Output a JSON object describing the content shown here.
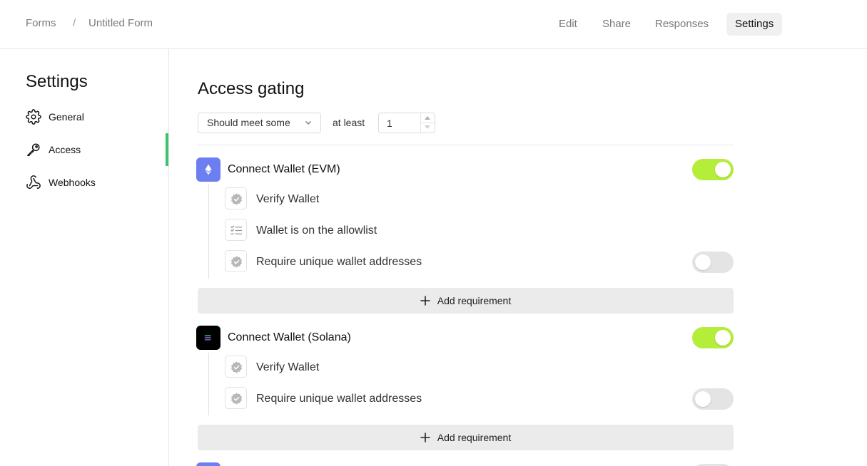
{
  "breadcrumb": {
    "root": "Forms",
    "separator": "/",
    "current": "Untitled Form"
  },
  "topnav": {
    "edit": "Edit",
    "share": "Share",
    "responses": "Responses",
    "settings": "Settings",
    "active": "Settings"
  },
  "sidebar": {
    "title": "Settings",
    "items": [
      {
        "label": "General",
        "icon": "gear-icon"
      },
      {
        "label": "Access",
        "icon": "key-icon",
        "active": true
      },
      {
        "label": "Webhooks",
        "icon": "webhook-icon"
      }
    ],
    "active_color": "#3cc46a"
  },
  "main": {
    "title": "Access gating",
    "condition_select": "Should meet some",
    "at_least_label": "at least",
    "at_least_value": "1",
    "providers": [
      {
        "title": "Connect Wallet (EVM)",
        "icon": "ethereum-icon",
        "icon_color": "#6c7ef0",
        "enabled": true,
        "requirements": [
          {
            "label": "Verify Wallet",
            "icon": "verified-badge-icon",
            "toggle": null
          },
          {
            "label": "Wallet is on the allowlist",
            "icon": "checklist-icon",
            "toggle": null
          },
          {
            "label": "Require unique wallet addresses",
            "icon": "verified-badge-icon",
            "toggle": false
          }
        ],
        "add_label": "Add requirement"
      },
      {
        "title": "Connect Wallet (Solana)",
        "icon": "solana-icon",
        "icon_color": "#000000",
        "enabled": true,
        "requirements": [
          {
            "label": "Verify Wallet",
            "icon": "verified-badge-icon",
            "toggle": null
          },
          {
            "label": "Require unique wallet addresses",
            "icon": "verified-badge-icon",
            "toggle": false
          }
        ],
        "add_label": "Add requirement"
      }
    ],
    "toggle_on_color": "#b5ee3a",
    "toggle_off_color": "#e4e4e4"
  }
}
